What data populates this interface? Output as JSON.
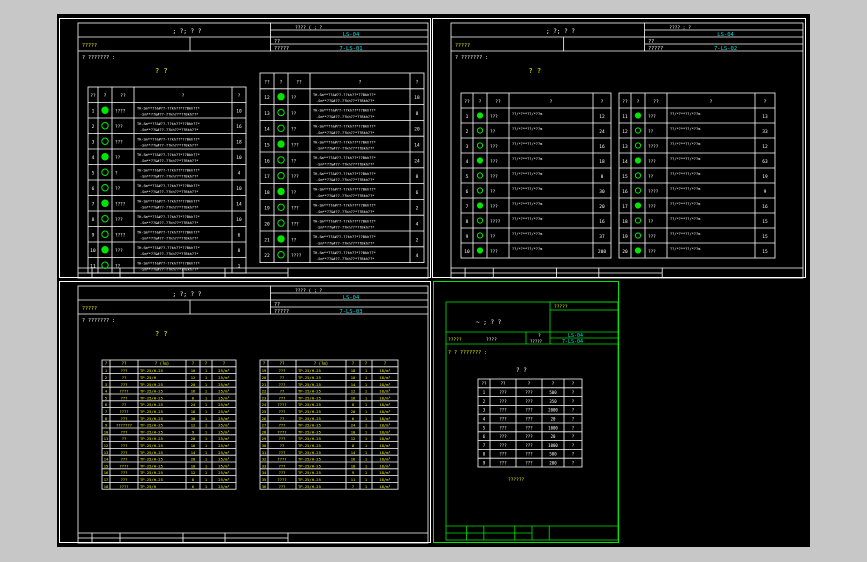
{
  "window": {
    "background": "#c7c7c7",
    "canvas_background": "#000000",
    "line_white": "#ffffff",
    "text_yellow": "#f2f200",
    "text_cyan": "#00e0e0",
    "text_green": "#00e600"
  },
  "sheets": [
    {
      "title_marks": "; ?; ?  ?",
      "header_right_top": "???? ( ; ?",
      "project_label": "?????",
      "code_label": "??",
      "drawing_label": "?????",
      "code": "LS-04",
      "drawing_no": "7-LS-01",
      "note": "?  ??????? :",
      "table_title": "?  ?",
      "headers": [
        "??",
        "?",
        "??",
        "?",
        "?"
      ],
      "rows_left": [
        {
          "n": "1",
          "name": "????",
          "spec": "TH-Sm**??&#??-??kh??*??Bkh??*",
          "q": "10"
        },
        {
          "n": "2",
          "name": "???",
          "spec": "TH-Sm**??&#??-??kh??*??Bkh??*",
          "q": "16"
        },
        {
          "n": "3",
          "name": "???",
          "spec": "TH-Sm**??&#??-??kh??*??Bkh??*",
          "q": "18"
        },
        {
          "n": "4",
          "name": "??",
          "spec": "TH-Sm**??&#??-??kh??*??Bkh??*",
          "q": "10"
        },
        {
          "n": "5",
          "name": "?",
          "spec": "TH-Sm**??&#??-??kh??*??Bkh??*",
          "q": "4"
        },
        {
          "n": "6",
          "name": "??",
          "spec": "TH-Sm**??&#??-??kh??*??Bkh??*",
          "q": "10"
        },
        {
          "n": "7",
          "name": "????",
          "spec": "TH-Sm**??&#??-??kh??*??Bkh??*",
          "q": "14"
        },
        {
          "n": "8",
          "name": "???",
          "spec": "TH-Sm**??&#??-??kh??*??Bkh??*",
          "q": "10"
        },
        {
          "n": "9",
          "name": "????",
          "spec": "TH-Sm**??&#??-??kh??*??Bkh??*",
          "q": "6"
        },
        {
          "n": "10",
          "name": "???",
          "spec": "TH-Sm**??&#??-??kh??*??Bkh??*",
          "q": "8"
        },
        {
          "n": "11",
          "name": "??",
          "spec": "TH-Sm**??&#??-??kh??*??Bkh??*",
          "q": "1"
        }
      ],
      "rows_right": [
        {
          "n": "12",
          "name": "??",
          "spec": "TH-Sm**??&#??-??kh??*??Bkh??*",
          "q": "18"
        },
        {
          "n": "13",
          "name": "??",
          "spec": "TH-Sm**??&#??-??kh??*??Bkh??*",
          "q": "8"
        },
        {
          "n": "14",
          "name": "??",
          "spec": "TH-Sm**??&#??-??kh??*??Bkh??*",
          "q": "20"
        },
        {
          "n": "15",
          "name": "???",
          "spec": "TH-Sm**??&#??-??kh??*??Bkh??*",
          "q": "14"
        },
        {
          "n": "16",
          "name": "??",
          "spec": "TH-Sm**??&#??-??kh??*??Bkh??*",
          "q": "24"
        },
        {
          "n": "17",
          "name": "???",
          "spec": "TH-Sm**??&#??-??kh??*??Bkh??*",
          "q": "8"
        },
        {
          "n": "18",
          "name": "??",
          "spec": "TH-Sm**??&#??-??kh??*??Bkh??*",
          "q": "6"
        },
        {
          "n": "19",
          "name": "???",
          "spec": "TH-Sm**??&#??-??kh??*??Bkh??*",
          "q": "2"
        },
        {
          "n": "20",
          "name": "???",
          "spec": "TH-Sm**??&#??-??kh??*??Bkh??*",
          "q": "4"
        },
        {
          "n": "21",
          "name": "??",
          "spec": "TH-Sm**??&#??-??kh??*??Bkh??*",
          "q": "2"
        },
        {
          "n": "22",
          "name": "????",
          "spec": "TH-Sm**??&#??-??kh??*??Bkh??*",
          "q": "4"
        }
      ]
    },
    {
      "title_marks": "; ?; ?  ?",
      "header_right_top": "????  ;  ?",
      "project_label": "?????",
      "code_label": "??",
      "drawing_label": "?????",
      "code": "LS-04",
      "drawing_no": "7-LS-02",
      "note": "?  ??????? :",
      "table_title": "?  ?",
      "headers": [
        "??",
        "?",
        "??",
        "?",
        "?"
      ],
      "rows_left": [
        {
          "n": "1",
          "name": "???",
          "spec": "??/*?**??/*??m",
          "q": "12"
        },
        {
          "n": "2",
          "name": "??",
          "spec": "??/*?**??/*??m",
          "q": "24"
        },
        {
          "n": "3",
          "name": "???",
          "spec": "??/*?**??/*??m",
          "q": "16"
        },
        {
          "n": "4",
          "name": "???",
          "spec": "??/*?**??/*??m",
          "q": "18"
        },
        {
          "n": "5",
          "name": "???",
          "spec": "??/*?**??/*??m",
          "q": "8"
        },
        {
          "n": "6",
          "name": "??",
          "spec": "??/*?**??/*??m",
          "q": "30"
        },
        {
          "n": "7",
          "name": "???",
          "spec": "??/*?**??/*??m",
          "q": "20"
        },
        {
          "n": "8",
          "name": "????",
          "spec": "??/*?**??/*??m",
          "q": "16"
        },
        {
          "n": "9",
          "name": "??",
          "spec": "??/*?**??/*??m",
          "q": "37"
        },
        {
          "n": "10",
          "name": "???",
          "spec": "??/*?**??/*??m",
          "q": "200"
        }
      ],
      "rows_right": [
        {
          "n": "11",
          "name": "???",
          "spec": "??/*?**??/*??m",
          "q": "13"
        },
        {
          "n": "12",
          "name": "??",
          "spec": "??/*?**??/*??m",
          "q": "33"
        },
        {
          "n": "13",
          "name": "????",
          "spec": "??/*?**??/*??m",
          "q": "12"
        },
        {
          "n": "14",
          "name": "???",
          "spec": "??/*?**??/*??m",
          "q": "63"
        },
        {
          "n": "15",
          "name": "??",
          "spec": "??/*?**??/*??m",
          "q": "19"
        },
        {
          "n": "16",
          "name": "????",
          "spec": "??/*?**??/*??m",
          "q": "9"
        },
        {
          "n": "17",
          "name": "???",
          "spec": "??/*?**??/*??m",
          "q": "16"
        },
        {
          "n": "18",
          "name": "??",
          "spec": "??/*?**??/*??m",
          "q": "15"
        },
        {
          "n": "19",
          "name": "???",
          "spec": "??/*?**??/*??m",
          "q": "15"
        },
        {
          "n": "20",
          "name": "???",
          "spec": "??/*?**??/*??m",
          "q": "15"
        }
      ]
    },
    {
      "title_marks": "; ?; ?  ?",
      "header_right_top": "???? (  ;  ?",
      "project_label": "?????",
      "code_label": "??",
      "drawing_label": "?????",
      "code": "LS-04",
      "drawing_no": "7-LS-03",
      "note": "?  ??????? :",
      "table_title": "?  ?",
      "headers": [
        "?",
        "??",
        "? (?m)",
        "?",
        "?",
        "?"
      ],
      "rows_left": [
        {
          "n": "1",
          "name": "???",
          "spec": "TP-25/H-25",
          "a": "10",
          "b": "1",
          "c": "25/m²"
        },
        {
          "n": "2",
          "name": "??",
          "spec": "TP-25/H",
          "a": "12",
          "b": "1",
          "c": "25/m²"
        },
        {
          "n": "3",
          "name": "???",
          "spec": "TP-25/H-25",
          "a": "20",
          "b": "1",
          "c": "25/m²"
        },
        {
          "n": "4",
          "name": "????",
          "spec": "TP-25/H-25",
          "a": "16",
          "b": "1",
          "c": "25/m²"
        },
        {
          "n": "5",
          "name": "???",
          "spec": "TP-25/H-25",
          "a": "8",
          "b": "1",
          "c": "25/m²"
        },
        {
          "n": "6",
          "name": "??",
          "spec": "TP-25/H-25",
          "a": "24",
          "b": "1",
          "c": "25/m²"
        },
        {
          "n": "7",
          "name": "????",
          "spec": "TP-25/H-25",
          "a": "18",
          "b": "1",
          "c": "25/m²"
        },
        {
          "n": "8",
          "name": "???",
          "spec": "TP-25/H-25",
          "a": "30",
          "b": "1",
          "c": "25/m²"
        },
        {
          "n": "9",
          "name": "???????",
          "spec": "TP-25/H-25",
          "a": "12",
          "b": "1",
          "c": "25/m²"
        },
        {
          "n": "10",
          "name": "???",
          "spec": "TP-25/H-25",
          "a": "9",
          "b": "1",
          "c": "25/m²"
        },
        {
          "n": "11",
          "name": "??",
          "spec": "TP-25/H-25",
          "a": "20",
          "b": "1",
          "c": "25/m²"
        },
        {
          "n": "12",
          "name": "???",
          "spec": "TP-25/H-25",
          "a": "16",
          "b": "1",
          "c": "25/m²"
        },
        {
          "n": "13",
          "name": "???",
          "spec": "TP-25/H-25",
          "a": "14",
          "b": "1",
          "c": "25/m²"
        },
        {
          "n": "14",
          "name": "???",
          "spec": "TP-25/H-25",
          "a": "28",
          "b": "1",
          "c": "25/m²"
        },
        {
          "n": "15",
          "name": "????",
          "spec": "TP-25/H-25",
          "a": "10",
          "b": "1",
          "c": "25/m²"
        },
        {
          "n": "16",
          "name": "???",
          "spec": "TP-25/H-25",
          "a": "12",
          "b": "1",
          "c": "25/m²"
        },
        {
          "n": "17",
          "name": "???",
          "spec": "TP-25/H-25",
          "a": "8",
          "b": "1",
          "c": "25/m²"
        },
        {
          "n": "18",
          "name": "????",
          "spec": "TP-25/H",
          "a": "6",
          "b": "1",
          "c": "25/m²"
        }
      ],
      "rows_right": [
        {
          "n": "19",
          "name": "???",
          "spec": "TP-25/H-25",
          "a": "18",
          "b": "1",
          "c": "18/m²"
        },
        {
          "n": "20",
          "name": "??",
          "spec": "TP-25/H-25",
          "a": "10",
          "b": "1",
          "c": "18/m²"
        },
        {
          "n": "21",
          "name": "???",
          "spec": "TP-25/H-25",
          "a": "14",
          "b": "1",
          "c": "18/m²"
        },
        {
          "n": "22",
          "name": "??",
          "spec": "TP-25/H-25",
          "a": "12",
          "b": "1",
          "c": "18/m²"
        },
        {
          "n": "23",
          "name": "???",
          "spec": "TP-25/H-25",
          "a": "16",
          "b": "1",
          "c": "18/m²"
        },
        {
          "n": "24",
          "name": "????",
          "spec": "TP-25/H-25",
          "a": "8",
          "b": "1",
          "c": "18/m²"
        },
        {
          "n": "25",
          "name": "???",
          "spec": "TP-25/H-25",
          "a": "20",
          "b": "1",
          "c": "18/m²"
        },
        {
          "n": "26",
          "name": "??",
          "spec": "TP-25/H-25",
          "a": "6",
          "b": "1",
          "c": "18/m²"
        },
        {
          "n": "27",
          "name": "???",
          "spec": "TP-25/H-25",
          "a": "24",
          "b": "1",
          "c": "18/m²"
        },
        {
          "n": "28",
          "name": "????",
          "spec": "TP-25/H-25",
          "a": "10",
          "b": "1",
          "c": "18/m²"
        },
        {
          "n": "29",
          "name": "???",
          "spec": "TP-25/H-25",
          "a": "12",
          "b": "1",
          "c": "18/m²"
        },
        {
          "n": "30",
          "name": "??",
          "spec": "TP-25/H-25",
          "a": "8",
          "b": "1",
          "c": "18/m²"
        },
        {
          "n": "31",
          "name": "???",
          "spec": "TP-25/H-25",
          "a": "14",
          "b": "1",
          "c": "18/m²"
        },
        {
          "n": "32",
          "name": "????",
          "spec": "TP-25/H-25",
          "a": "16",
          "b": "1",
          "c": "18/m²"
        },
        {
          "n": "33",
          "name": "???",
          "spec": "TP-25/H-25",
          "a": "18",
          "b": "1",
          "c": "18/m²"
        },
        {
          "n": "34",
          "name": "???",
          "spec": "TP-25/H-25",
          "a": "9",
          "b": "1",
          "c": "18/m²"
        },
        {
          "n": "35",
          "name": "????",
          "spec": "TP-25/H-25",
          "a": "11",
          "b": "1",
          "c": "18/m²"
        },
        {
          "n": "36",
          "name": "???",
          "spec": "TP-25/H-25",
          "a": "7",
          "b": "1",
          "c": "18/m²"
        }
      ]
    },
    {
      "title_marks": "~  ;  ?  ?",
      "header_top": "?????",
      "project_label": "?????",
      "project_value": "????",
      "code_label": "?",
      "drawing_label": "?????",
      "code": "LS-04",
      "drawing_no": "7-LS-04",
      "note": "?  ?  ??????? :",
      "table_title": "?  ?",
      "headers": [
        "??",
        "??",
        "?",
        "?",
        "?"
      ],
      "rows": [
        {
          "n": "1",
          "a": "???",
          "b": "???",
          "c": "500",
          "d": "?"
        },
        {
          "n": "2",
          "a": "???",
          "b": "???",
          "c": "350",
          "d": "?"
        },
        {
          "n": "3",
          "a": "???",
          "b": "???",
          "c": "2000",
          "d": "?"
        },
        {
          "n": "4",
          "a": "???",
          "b": "???",
          "c": "20",
          "d": "?"
        },
        {
          "n": "5",
          "a": "???",
          "b": "???",
          "c": "1000",
          "d": "?"
        },
        {
          "n": "6",
          "a": "???",
          "b": "???",
          "c": "20",
          "d": "?"
        },
        {
          "n": "7",
          "a": "???",
          "b": "???",
          "c": "1000",
          "d": "?"
        },
        {
          "n": "8",
          "a": "???",
          "b": "???",
          "c": "500",
          "d": "?"
        },
        {
          "n": "9",
          "a": "???",
          "b": "???",
          "c": "200",
          "d": "?"
        }
      ],
      "footer_note": "??????"
    }
  ]
}
